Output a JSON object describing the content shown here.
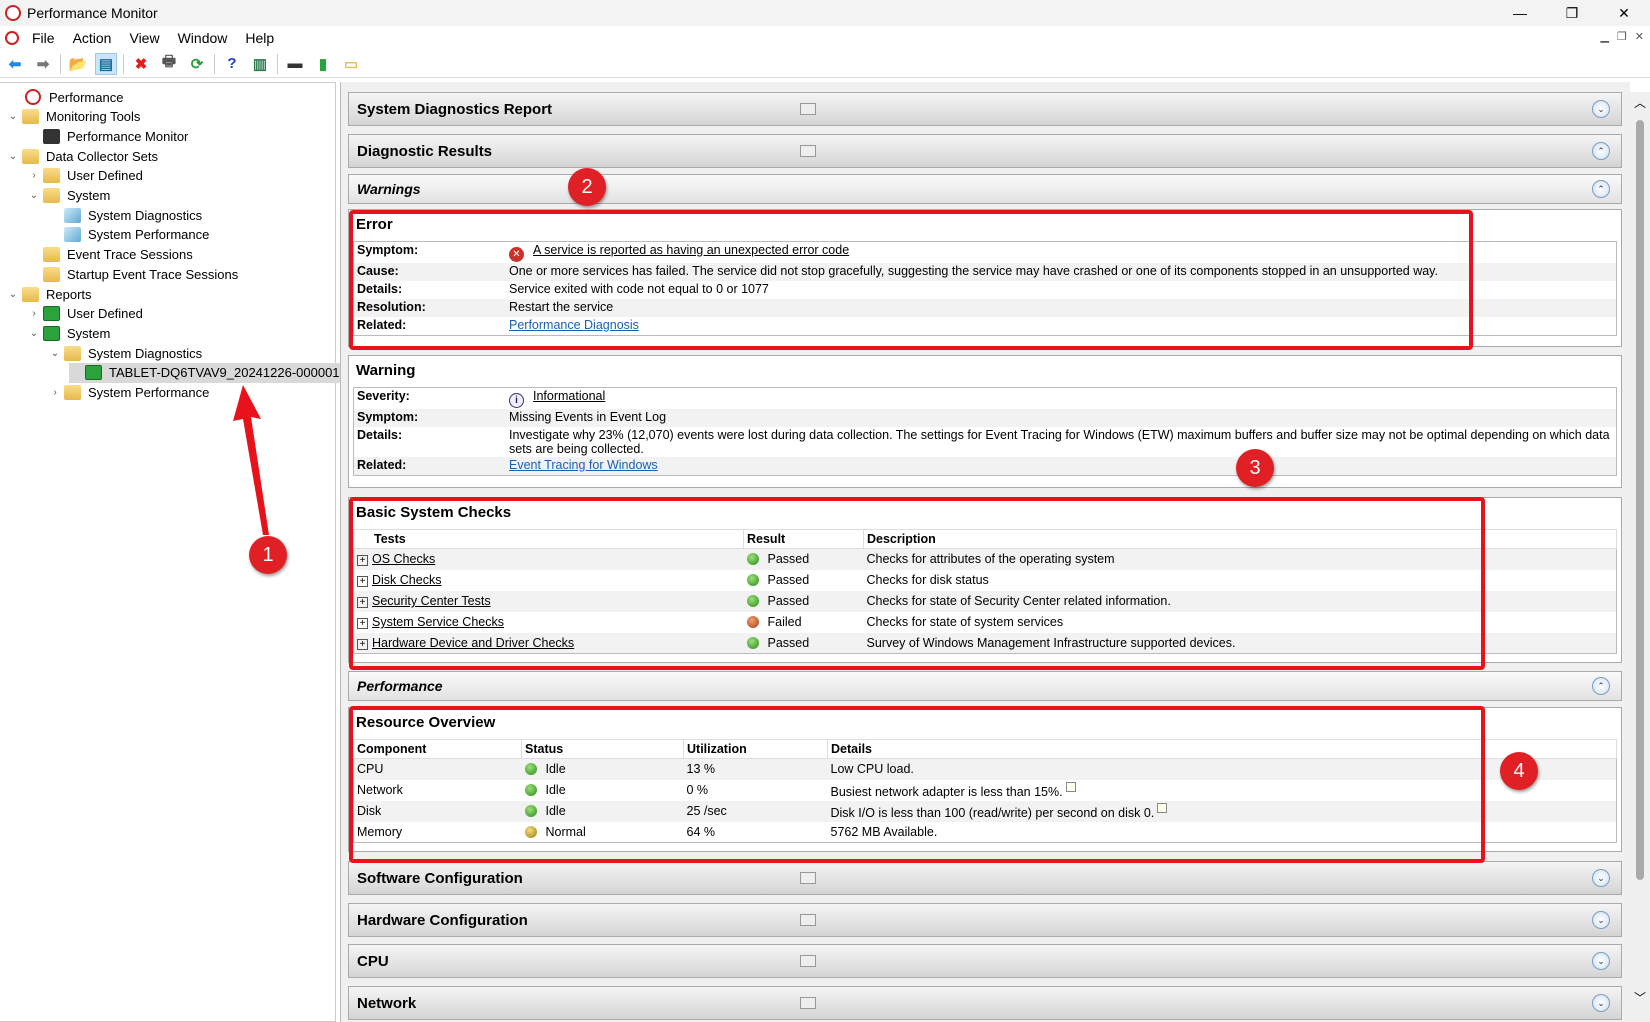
{
  "window": {
    "title": "Performance Monitor",
    "minimize": "—",
    "restore": "❐",
    "close": "✕"
  },
  "menu": [
    "File",
    "Action",
    "View",
    "Window",
    "Help"
  ],
  "toolbar": [
    {
      "icon": "back-icon",
      "glyph": "⬅",
      "color": "#1e88e5"
    },
    {
      "icon": "forward-icon",
      "glyph": "➡",
      "color": "#777"
    },
    {
      "icon": "up-folder-icon",
      "glyph": "📂",
      "color": "#d9a400"
    },
    {
      "icon": "show-hide-tree-icon",
      "glyph": "▤",
      "color": "#1b6a9a"
    },
    {
      "icon": "delete-icon",
      "glyph": "✖",
      "color": "#e02020"
    },
    {
      "icon": "print-icon",
      "glyph": "🖶",
      "color": "#555"
    },
    {
      "icon": "refresh-icon",
      "glyph": "⟳",
      "color": "#2a9d3a"
    },
    {
      "icon": "help-icon",
      "glyph": "?",
      "color": "#1f3fbf"
    },
    {
      "icon": "show-action-pane-icon",
      "glyph": "▥",
      "color": "#2a7a4a"
    },
    {
      "icon": "performance-monitor-icon",
      "glyph": "▬",
      "color": "#333"
    },
    {
      "icon": "report-icon",
      "glyph": "▮",
      "color": "#2aa33b"
    },
    {
      "icon": "folder-icon",
      "glyph": "▭",
      "color": "#e7c25a"
    }
  ],
  "tree": [
    {
      "label": "Performance",
      "level": 0,
      "chev": "",
      "icon": "performance-icon"
    },
    {
      "label": "Monitoring Tools",
      "level": 0,
      "chev": "⌄",
      "icon": "folder"
    },
    {
      "label": "Performance Monitor",
      "level": 1,
      "chev": "",
      "icon": "monitor"
    },
    {
      "label": "Data Collector Sets",
      "level": 0,
      "chev": "⌄",
      "icon": "folder"
    },
    {
      "label": "User Defined",
      "level": 1,
      "chev": "›",
      "icon": "folder"
    },
    {
      "label": "System",
      "level": 1,
      "chev": "⌄",
      "icon": "folder"
    },
    {
      "label": "System Diagnostics",
      "level": 2,
      "chev": "",
      "icon": "cube"
    },
    {
      "label": "System Performance",
      "level": 2,
      "chev": "",
      "icon": "cube"
    },
    {
      "label": "Event Trace Sessions",
      "level": 1,
      "chev": "",
      "icon": "folder"
    },
    {
      "label": "Startup Event Trace Sessions",
      "level": 1,
      "chev": "",
      "icon": "folder"
    },
    {
      "label": "Reports",
      "level": 0,
      "chev": "⌄",
      "icon": "folder"
    },
    {
      "label": "User Defined",
      "level": 1,
      "chev": "›",
      "icon": "green"
    },
    {
      "label": "System",
      "level": 1,
      "chev": "⌄",
      "icon": "green"
    },
    {
      "label": "System Diagnostics",
      "level": 2,
      "chev": "⌄",
      "icon": "folder"
    },
    {
      "label": "TABLET-DQ6TVAV9_20241226-000001",
      "level": 3,
      "chev": "",
      "icon": "green",
      "selected": true
    },
    {
      "label": "System Performance",
      "level": 2,
      "chev": "›",
      "icon": "folder"
    }
  ],
  "report": {
    "title": "System Diagnostics Report",
    "diagnostic_results": "Diagnostic Results",
    "warnings": "Warnings",
    "error": {
      "heading": "Error",
      "rows": [
        {
          "k": "Symptom:",
          "v": "A service is reported as having an unexpected error code"
        },
        {
          "k": "Cause:",
          "v": "One or more services has failed. The service did not stop gracefully, suggesting the service may have crashed or one of its components stopped in an unsupported way."
        },
        {
          "k": "Details:",
          "v": "Service exited with code not equal to 0 or 1077"
        },
        {
          "k": "Resolution:",
          "v": "Restart the service"
        },
        {
          "k": "Related:",
          "v": "Performance Diagnosis"
        }
      ]
    },
    "warning": {
      "heading": "Warning",
      "rows": [
        {
          "k": "Severity:",
          "v": "Informational"
        },
        {
          "k": "Symptom:",
          "v": "Missing Events in Event Log"
        },
        {
          "k": "Details:",
          "v": "Investigate why 23% (12,070) events were lost during data collection. The settings for Event Tracing for Windows (ETW) maximum buffers and buffer size may not be optimal depending on which data sets are being collected."
        },
        {
          "k": "Related:",
          "v": "Event Tracing for Windows"
        }
      ]
    },
    "basic_checks": {
      "heading": "Basic System Checks",
      "columns": [
        "Tests",
        "Result",
        "Description"
      ],
      "rows": [
        {
          "test": "OS Checks",
          "result": "Passed",
          "status": "g",
          "desc": "Checks for attributes of the operating system"
        },
        {
          "test": "Disk Checks",
          "result": "Passed",
          "status": "g",
          "desc": "Checks for disk status"
        },
        {
          "test": "Security Center Tests",
          "result": "Passed",
          "status": "g",
          "desc": "Checks for state of Security Center related information."
        },
        {
          "test": "System Service Checks",
          "result": "Failed",
          "status": "r",
          "desc": "Checks for state of system services"
        },
        {
          "test": "Hardware Device and Driver Checks",
          "result": "Passed",
          "status": "g",
          "desc": "Survey of Windows Management Infrastructure supported devices."
        }
      ]
    },
    "performance": "Performance",
    "resource": {
      "heading": "Resource Overview",
      "columns": [
        "Component",
        "Status",
        "Utilization",
        "Details"
      ],
      "rows": [
        {
          "c": "CPU",
          "s": "Idle",
          "st": "g",
          "u": "13 %",
          "d": "Low CPU load.",
          "note": false
        },
        {
          "c": "Network",
          "s": "Idle",
          "st": "g",
          "u": "0 %",
          "d": "Busiest network adapter is less than 15%.",
          "note": true
        },
        {
          "c": "Disk",
          "s": "Idle",
          "st": "g",
          "u": "25 /sec",
          "d": "Disk I/O is less than 100 (read/write) per second on disk 0.",
          "note": true
        },
        {
          "c": "Memory",
          "s": "Normal",
          "st": "y",
          "u": "64 %",
          "d": "5762 MB Available.",
          "note": false
        }
      ]
    },
    "software": "Software Configuration",
    "hardware": "Hardware Configuration",
    "cpu": "CPU",
    "network": "Network"
  },
  "annotations": [
    "1",
    "2",
    "3",
    "4"
  ],
  "annotation_color": "#e8121b"
}
